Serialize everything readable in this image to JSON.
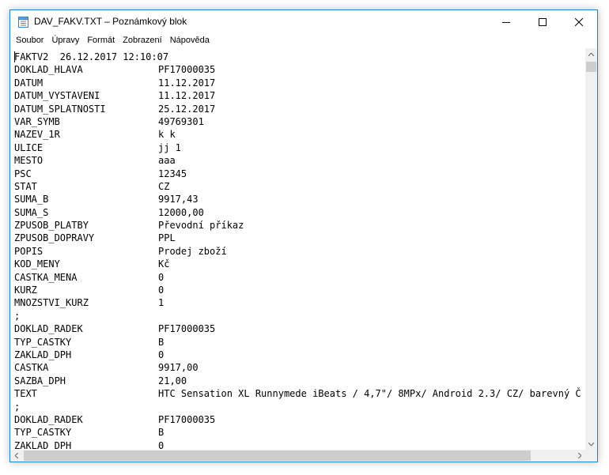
{
  "window": {
    "title": "DAV_FAKV.TXT – Poznámkový blok"
  },
  "menu": [
    "Soubor",
    "Úpravy",
    "Formát",
    "Zobrazení",
    "Nápověda"
  ],
  "content": {
    "header_line": "FAKTV2  26.12.2017 12:10:07",
    "rows": [
      {
        "key": "DOKLAD_HLAVA",
        "value": "PF17000035"
      },
      {
        "key": "DATUM",
        "value": "11.12.2017"
      },
      {
        "key": "DATUM_VYSTAVENI",
        "value": "11.12.2017"
      },
      {
        "key": "DATUM_SPLATNOSTI",
        "value": "25.12.2017"
      },
      {
        "key": "VAR_SYMB",
        "value": "49769301"
      },
      {
        "key": "NAZEV_1R",
        "value": "k k"
      },
      {
        "key": "ULICE",
        "value": "jj 1"
      },
      {
        "key": "MESTO",
        "value": "aaa"
      },
      {
        "key": "PSC",
        "value": "12345"
      },
      {
        "key": "STAT",
        "value": "CZ"
      },
      {
        "key": "SUMA_B",
        "value": "9917,43"
      },
      {
        "key": "SUMA_S",
        "value": "12000,00"
      },
      {
        "key": "ZPUSOB_PLATBY",
        "value": "Převodní příkaz"
      },
      {
        "key": "ZPUSOB_DOPRAVY",
        "value": "PPL"
      },
      {
        "key": "POPIS",
        "value": "Prodej zboží"
      },
      {
        "key": "KOD_MENY",
        "value": "Kč"
      },
      {
        "key": "CASTKA_MENA",
        "value": "0"
      },
      {
        "key": "KURZ",
        "value": "0"
      },
      {
        "key": "MNOZSTVI_KURZ",
        "value": "1"
      },
      {
        "key": ";",
        "value": ""
      },
      {
        "key": "DOKLAD_RADEK",
        "value": "PF17000035"
      },
      {
        "key": "TYP_CASTKY",
        "value": "B"
      },
      {
        "key": "ZAKLAD_DPH",
        "value": "0"
      },
      {
        "key": "CASTKA",
        "value": "9917,00"
      },
      {
        "key": "SAZBA_DPH",
        "value": "21,00"
      },
      {
        "key": "TEXT",
        "value": "HTC Sensation XL Runnymede iBeats / 4,7\"/ 8MPx/ Android 2.3/ CZ/ barevný Č"
      },
      {
        "key": ";",
        "value": ""
      },
      {
        "key": "DOKLAD_RADEK",
        "value": "PF17000035"
      },
      {
        "key": "TYP_CASTKY",
        "value": "B"
      },
      {
        "key": "ZAKLAD_DPH",
        "value": "0"
      }
    ]
  }
}
